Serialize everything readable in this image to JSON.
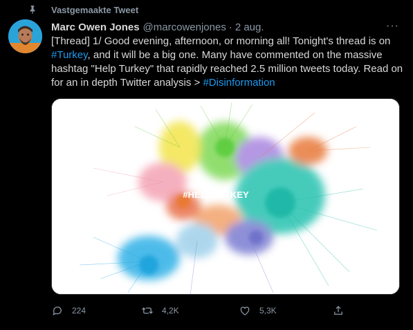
{
  "pinned": {
    "label": "Vastgemaakte Tweet",
    "icon": "pin-icon"
  },
  "author": {
    "name": "Marc Owen Jones",
    "handle": "@marcowenjones",
    "date": "2 aug."
  },
  "tweet": {
    "t1": "[Thread] 1/ Good evening, afternoon, or morning all! Tonight's thread is on ",
    "tag1": "#Turkey",
    "t2": ", and it will be a big one. Many have commented on the massive hashtag \"Help Turkey\" that rapidly reached 2.5 million tweets today. Read on for an in depth Twitter analysis > ",
    "tag2": "#Disinformation"
  },
  "media": {
    "overlay_text": "#HELPTURKEY"
  },
  "actions": {
    "reply": {
      "icon": "reply-icon",
      "count": "224"
    },
    "retweet": {
      "icon": "retweet-icon",
      "count": "4,2K"
    },
    "like": {
      "icon": "like-icon",
      "count": "5,3K"
    },
    "share": {
      "icon": "share-icon"
    }
  },
  "colors": {
    "accent": "#1d9bf0",
    "muted": "#8b98a5",
    "background": "#000000"
  }
}
